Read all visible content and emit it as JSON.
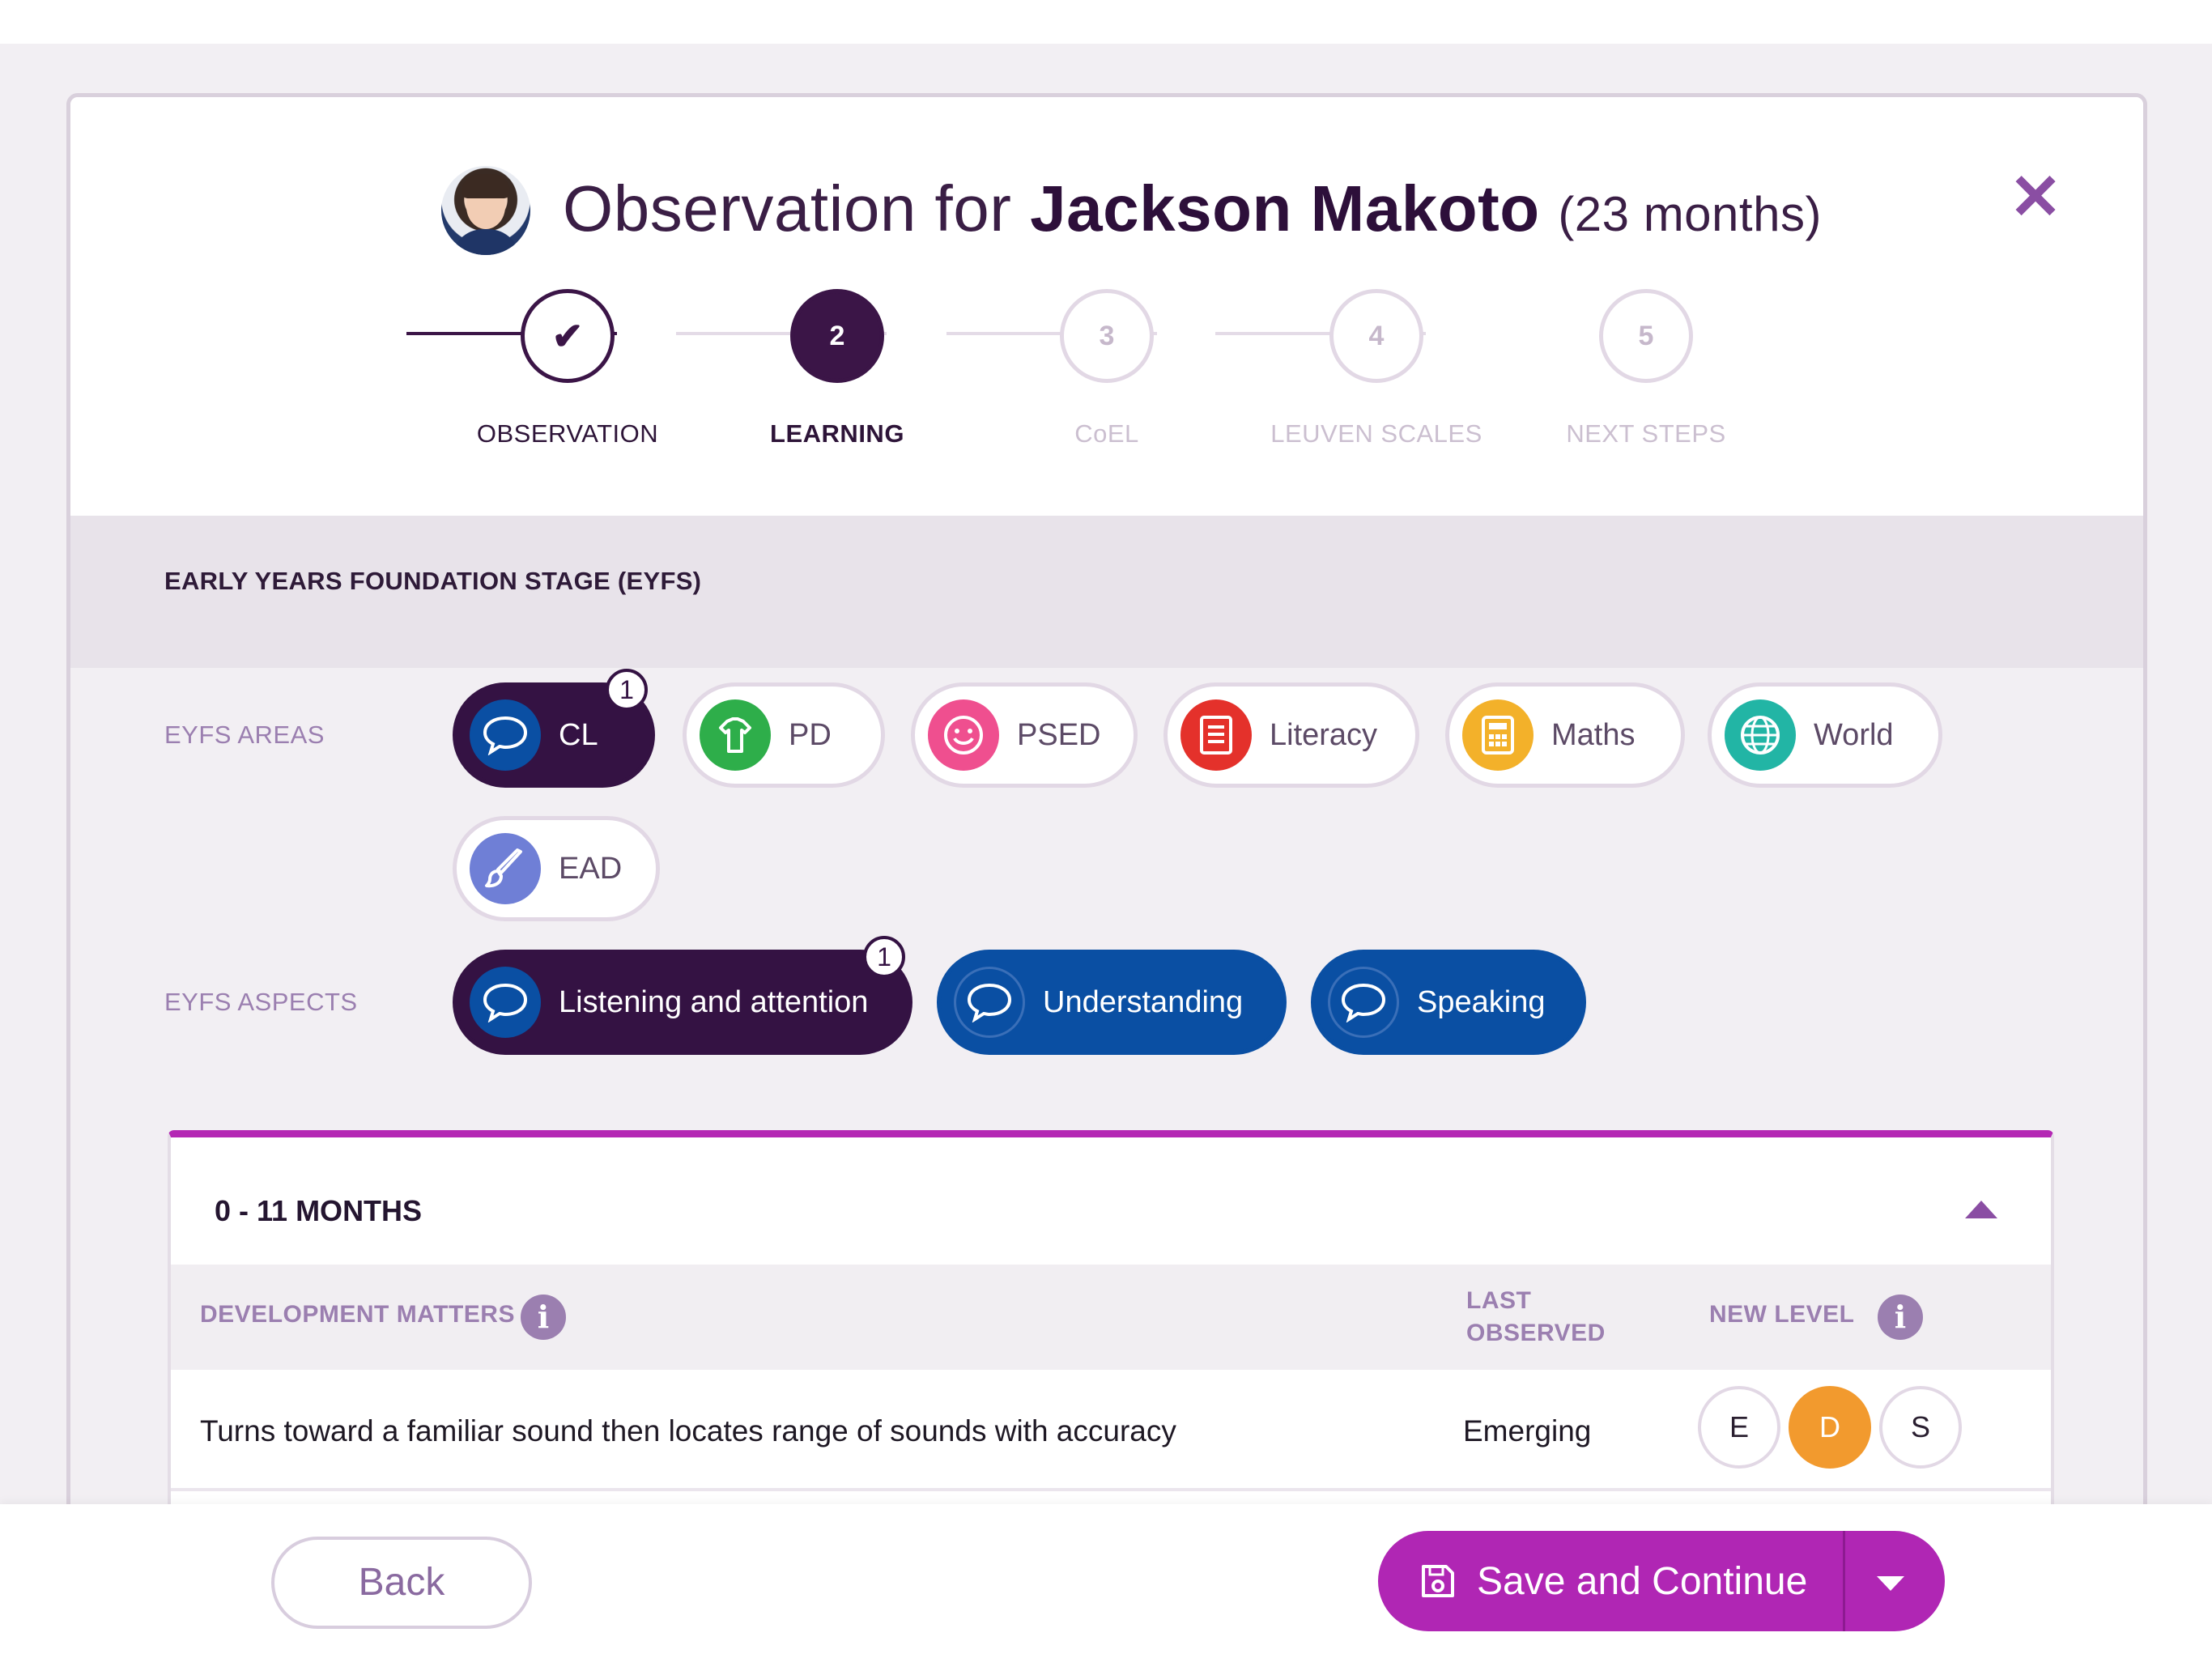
{
  "header": {
    "title_prefix": "Observation for",
    "child_name": "Jackson Makoto",
    "child_age": "(23 months)",
    "close_icon": "close-icon"
  },
  "stepper": {
    "steps": [
      {
        "number": "",
        "label": "OBSERVATION",
        "state": "done"
      },
      {
        "number": "2",
        "label": "LEARNING",
        "state": "active"
      },
      {
        "number": "3",
        "label": "CoEL",
        "state": "upcoming"
      },
      {
        "number": "4",
        "label": "LEUVEN SCALES",
        "state": "upcoming"
      },
      {
        "number": "5",
        "label": "NEXT STEPS",
        "state": "upcoming"
      }
    ]
  },
  "section": {
    "title": "EARLY YEARS FOUNDATION STAGE (EYFS)",
    "areas_label": "EYFS AREAS",
    "aspects_label": "EYFS ASPECTS"
  },
  "areas": [
    {
      "label": "CL",
      "icon": "speech-bubble-icon",
      "color": "#0a4fa3",
      "selected": true,
      "badge": "1"
    },
    {
      "label": "PD",
      "icon": "shirt-icon",
      "color": "#2eae4a",
      "selected": false
    },
    {
      "label": "PSED",
      "icon": "smiley-icon",
      "color": "#ef4f8f",
      "selected": false
    },
    {
      "label": "Literacy",
      "icon": "book-icon",
      "color": "#e4312b",
      "selected": false
    },
    {
      "label": "Maths",
      "icon": "calculator-icon",
      "color": "#f3b12a",
      "selected": false
    },
    {
      "label": "World",
      "icon": "globe-icon",
      "color": "#22b5a5",
      "selected": false
    },
    {
      "label": "EAD",
      "icon": "paintbrush-icon",
      "color": "#6f7fd6",
      "selected": false
    }
  ],
  "aspects": [
    {
      "label": "Listening and attention",
      "icon": "speech-bubble-icon",
      "selected": true,
      "badge": "1"
    },
    {
      "label": "Understanding",
      "icon": "speech-bubble-icon",
      "selected": false
    },
    {
      "label": "Speaking",
      "icon": "speech-bubble-icon",
      "selected": false
    }
  ],
  "panel": {
    "title": "0 - 11 MONTHS",
    "columns": {
      "development_matters": "DEVELOPMENT MATTERS",
      "last_observed_1": "LAST",
      "last_observed_2": "OBSERVED",
      "new_level": "NEW LEVEL"
    },
    "rows": [
      {
        "text": "Turns toward a familiar sound then locates range of sounds with accuracy",
        "last_observed": "Emerging",
        "levels": [
          "E",
          "D",
          "S"
        ],
        "selected_level": "D"
      }
    ]
  },
  "footer": {
    "back_label": "Back",
    "save_label": "Save and Continue"
  },
  "colors": {
    "primary_dark": "#341243",
    "accent_magenta": "#b026b4",
    "aspect_blue": "#0a4fa3",
    "level_selected": "#f29a2e"
  }
}
